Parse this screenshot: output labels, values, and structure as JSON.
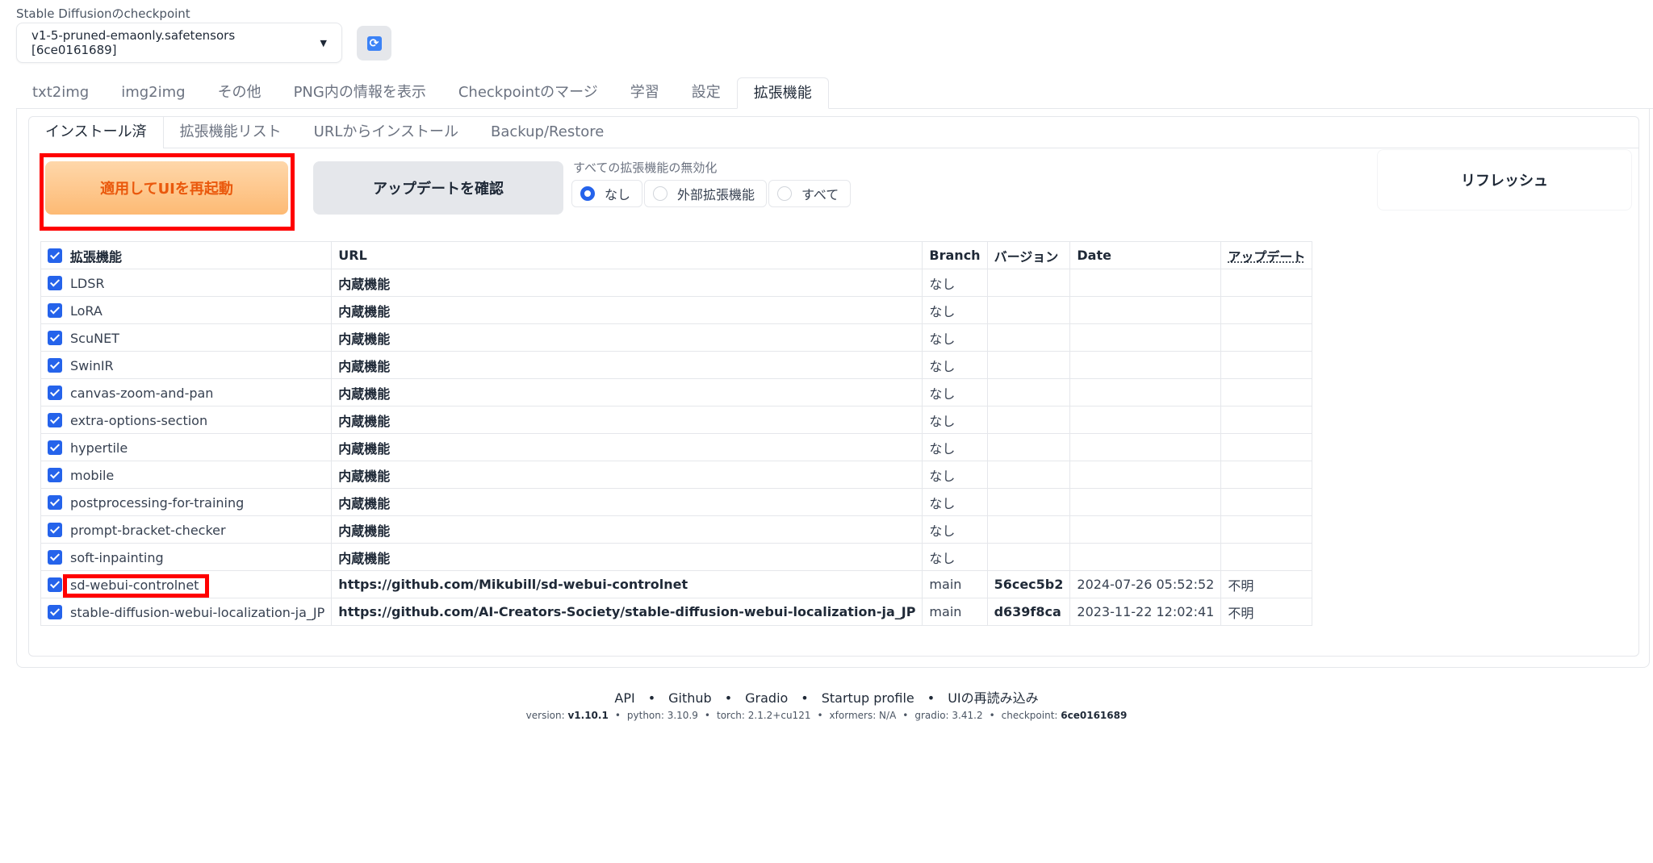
{
  "checkpoint": {
    "label": "Stable Diffusionのcheckpoint",
    "selected": "v1-5-pruned-emaonly.safetensors [6ce0161689]",
    "refresh_icon": "refresh-icon"
  },
  "main_tabs": [
    {
      "label": "txt2img"
    },
    {
      "label": "img2img"
    },
    {
      "label": "その他"
    },
    {
      "label": "PNG内の情報を表示"
    },
    {
      "label": "Checkpointのマージ"
    },
    {
      "label": "学習"
    },
    {
      "label": "設定"
    },
    {
      "label": "拡張機能"
    }
  ],
  "sub_tabs": [
    {
      "label": "インストール済"
    },
    {
      "label": "拡張機能リスト"
    },
    {
      "label": "URLからインストール"
    },
    {
      "label": "Backup/Restore"
    }
  ],
  "actions": {
    "apply_label": "適用してUIを再起動",
    "check_label": "アップデートを確認",
    "refresh_label": "リフレッシュ"
  },
  "disable": {
    "label": "すべての拡張機能の無効化",
    "options": [
      "なし",
      "外部拡張機能",
      "すべて"
    ],
    "selected": "なし"
  },
  "table": {
    "headers": {
      "name": "拡張機能",
      "url": "URL",
      "branch": "Branch",
      "version": "バージョン",
      "date": "Date",
      "update": "アップデート"
    },
    "rows": [
      {
        "name": "LDSR",
        "url": "内蔵機能",
        "branch": "なし",
        "version": "",
        "date": "",
        "update": ""
      },
      {
        "name": "LoRA",
        "url": "内蔵機能",
        "branch": "なし",
        "version": "",
        "date": "",
        "update": ""
      },
      {
        "name": "ScuNET",
        "url": "内蔵機能",
        "branch": "なし",
        "version": "",
        "date": "",
        "update": ""
      },
      {
        "name": "SwinIR",
        "url": "内蔵機能",
        "branch": "なし",
        "version": "",
        "date": "",
        "update": ""
      },
      {
        "name": "canvas-zoom-and-pan",
        "url": "内蔵機能",
        "branch": "なし",
        "version": "",
        "date": "",
        "update": ""
      },
      {
        "name": "extra-options-section",
        "url": "内蔵機能",
        "branch": "なし",
        "version": "",
        "date": "",
        "update": ""
      },
      {
        "name": "hypertile",
        "url": "内蔵機能",
        "branch": "なし",
        "version": "",
        "date": "",
        "update": ""
      },
      {
        "name": "mobile",
        "url": "内蔵機能",
        "branch": "なし",
        "version": "",
        "date": "",
        "update": ""
      },
      {
        "name": "postprocessing-for-training",
        "url": "内蔵機能",
        "branch": "なし",
        "version": "",
        "date": "",
        "update": ""
      },
      {
        "name": "prompt-bracket-checker",
        "url": "内蔵機能",
        "branch": "なし",
        "version": "",
        "date": "",
        "update": ""
      },
      {
        "name": "soft-inpainting",
        "url": "内蔵機能",
        "branch": "なし",
        "version": "",
        "date": "",
        "update": ""
      },
      {
        "name": "sd-webui-controlnet",
        "url": "https://github.com/Mikubill/sd-webui-controlnet",
        "branch": "main",
        "version": "56cec5b2",
        "date": "2024-07-26 05:52:52",
        "update": "不明"
      },
      {
        "name": "stable-diffusion-webui-localization-ja_JP",
        "url": "https://github.com/AI-Creators-Society/stable-diffusion-webui-localization-ja_JP",
        "branch": "main",
        "version": "d639f8ca",
        "date": "2023-11-22 12:02:41",
        "update": "不明"
      }
    ]
  },
  "footer": {
    "links": [
      "API",
      "Github",
      "Gradio",
      "Startup profile",
      "UIの再読み込み"
    ],
    "version": [
      {
        "key": "version: ",
        "value": "v1.10.1"
      },
      {
        "key": "python: 3.10.9",
        "value": ""
      },
      {
        "key": "torch: 2.1.2+cu121",
        "value": ""
      },
      {
        "key": "xformers: N/A",
        "value": ""
      },
      {
        "key": "gradio: 3.41.2",
        "value": ""
      },
      {
        "key": "checkpoint: ",
        "value": "6ce0161689"
      }
    ]
  },
  "colors": {
    "accent_blue": "#2563eb",
    "primary_orange": "#ea580c",
    "highlight_red": "#ff0000"
  }
}
